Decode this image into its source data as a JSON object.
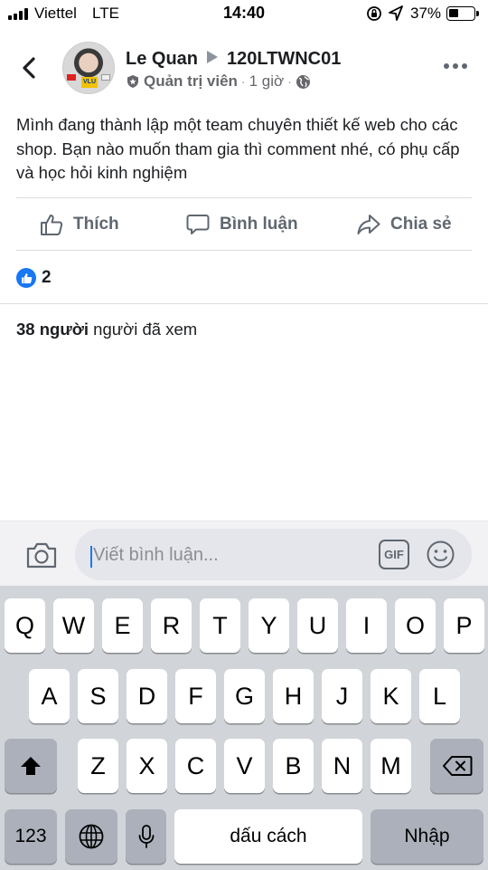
{
  "status_bar": {
    "carrier": "Viettel",
    "network": "LTE",
    "time": "14:40",
    "battery_percent": "37%",
    "battery_level": 0.37
  },
  "post": {
    "author": "Le Quan",
    "group": "120LTWNC01",
    "role": "Quản trị viên",
    "time_ago": "1 giờ",
    "text": "Mình đang thành lập một team chuyên thiết kế web cho các shop. Bạn nào muốn tham gia thì comment nhé, có phụ cấp và học hỏi kinh nghiệm",
    "avatar_badge": "VLU"
  },
  "actions": {
    "like": "Thích",
    "comment": "Bình luận",
    "share": "Chia sẻ"
  },
  "reactions": {
    "count": "2"
  },
  "seen": {
    "count_label": "38 người",
    "suffix": " người đã xem"
  },
  "comment_bar": {
    "placeholder": "Viết bình luận...",
    "gif_label": "GIF"
  },
  "keyboard": {
    "row1": [
      "Q",
      "W",
      "E",
      "R",
      "T",
      "Y",
      "U",
      "I",
      "O",
      "P"
    ],
    "row2": [
      "A",
      "S",
      "D",
      "F",
      "G",
      "H",
      "J",
      "K",
      "L"
    ],
    "row3": [
      "Z",
      "X",
      "C",
      "V",
      "B",
      "N",
      "M"
    ],
    "numbers_label": "123",
    "space_label": "dấu cách",
    "return_label": "Nhập"
  },
  "colors": {
    "accent": "#1877f2",
    "secondary_text": "#65676b",
    "keyboard_bg": "#d1d4d9"
  }
}
